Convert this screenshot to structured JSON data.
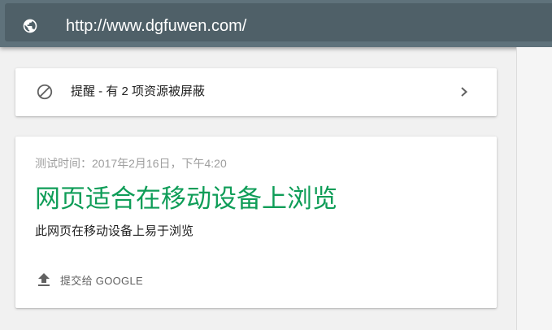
{
  "address_bar": {
    "icon": "globe-icon",
    "url": "http://www.dgfuwen.com/"
  },
  "alert": {
    "icon": "block-icon",
    "text": "提醒 - 有 2 项资源被屏蔽",
    "chevron": "chevron-right-icon"
  },
  "result": {
    "test_time": "测试时间：2017年2月16日，下午4:20",
    "headline": "网页适合在移动设备上浏览",
    "subtext": "此网页在移动设备上易于浏览",
    "submit_icon": "upload-icon",
    "submit_label": "提交给 GOOGLE"
  },
  "colors": {
    "topbar": "#5f727b",
    "urlbox": "#4f6068",
    "success_green": "#0f9d58",
    "page_background": "#f1f1f1"
  }
}
